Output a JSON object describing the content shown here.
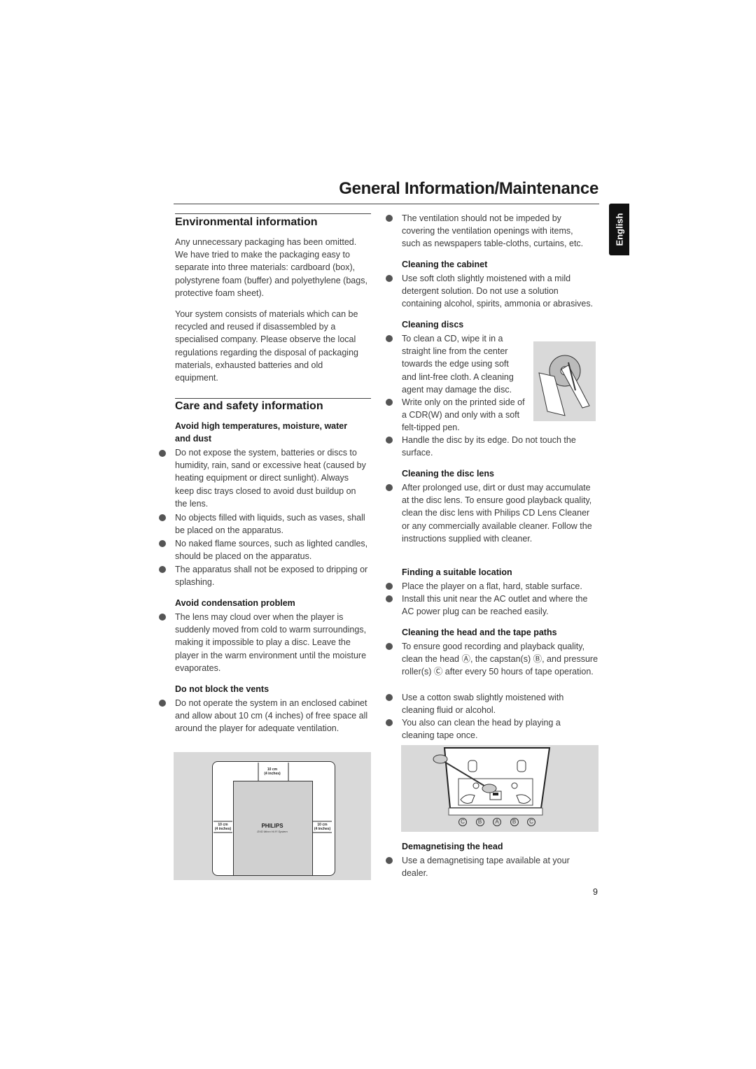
{
  "header": {
    "title": "General Information/Maintenance",
    "language_tab": "English"
  },
  "left": {
    "env_heading": "Environmental information",
    "env_p1": "Any unnecessary packaging has been omitted. We have tried to make the packaging easy to separate into three materials: cardboard (box), polystyrene foam (buffer) and polyethylene (bags, protective foam sheet).",
    "env_p2": "Your system consists of materials which can be recycled and reused if disassembled by a specialised company. Please observe the local regulations regarding the disposal of packaging materials, exhausted batteries and old equipment.",
    "care_heading": "Care and safety information",
    "avoid_heading": "Avoid high temperatures, moisture, water and dust",
    "avoid_bullets": [
      "Do not expose the system, batteries or discs to humidity, rain, sand or excessive heat (caused by heating equipment or direct sunlight). Always keep disc trays closed to avoid dust buildup on the lens.",
      "No objects filled with liquids, such as vases, shall be placed on the apparatus.",
      "No naked flame sources, such as lighted candles, should be placed on the apparatus.",
      "The apparatus shall not be exposed to dripping or splashing."
    ],
    "cond_heading": "Avoid condensation problem",
    "cond_bullet": "The lens may cloud over when the player is suddenly moved from cold to warm surroundings, making it impossible to play a disc. Leave the player in the warm environment until the moisture evaporates.",
    "vents_heading": "Do not block the vents",
    "vents_bullet": "Do not operate the system in an enclosed cabinet and allow about 10 cm (4 inches) of free space all around the player for adequate ventilation.",
    "figure": {
      "top_cm": "10 cm",
      "top_in": "(4 inches)",
      "left_cm": "10 cm",
      "left_in": "(4 inches)",
      "right_cm": "10 cm",
      "right_in": "(4 inches)",
      "brand": "PHILIPS",
      "model": "DVD Micro Hi-Fi System"
    }
  },
  "right": {
    "vent_bullet": "The ventilation should not be impeded by covering the ventilation openings with items, such as newspapers table-cloths, curtains, etc.",
    "cabinet_heading": "Cleaning the cabinet",
    "cabinet_bullet": "Use soft cloth slightly moistened with a mild detergent solution. Do not use a solution containing alcohol, spirits, ammonia or abrasives.",
    "discs_heading": "Cleaning discs",
    "discs_bullets": [
      "To clean a CD, wipe it in a straight line from the center towards the edge using soft and lint-free cloth. A cleaning agent may damage the disc.",
      "Write only on the printed side of a CDR(W) and only with a soft felt-tipped pen.",
      "Handle the disc by its edge. Do not touch the surface."
    ],
    "lens_heading": "Cleaning the disc lens",
    "lens_bullet": "After prolonged use, dirt or dust may accumulate at the disc lens. To ensure good playback quality, clean the disc lens with Philips CD Lens Cleaner or any commercially available cleaner. Follow the instructions supplied with cleaner.",
    "location_heading": "Finding a suitable location",
    "location_bullets": [
      "Place the player on a flat, hard, stable surface.",
      "Install this unit near the AC outlet and where the AC power plug can be reached easily."
    ],
    "head_heading": "Cleaning the head and the tape paths",
    "head_bullets": [
      "To ensure good recording and playback quality, clean the head Ⓐ, the capstan(s) Ⓑ, and pressure roller(s) Ⓒ after every 50 hours of tape operation.",
      "Use a cotton swab slightly moistened with cleaning fluid or alcohol.",
      "You also can clean the head  by playing a cleaning tape once."
    ],
    "head_figure_labels": [
      "C",
      "B",
      "A",
      "B",
      "C"
    ],
    "demag_heading": "Demagnetising the head",
    "demag_bullet": "Use a demagnetising tape available at your dealer."
  },
  "footer": {
    "page_number": "9"
  }
}
